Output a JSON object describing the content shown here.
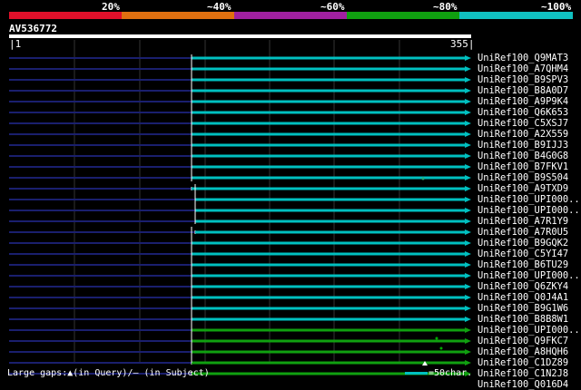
{
  "percent_scale": {
    "labels": [
      "20%",
      "~40%",
      "~60%",
      "~80%",
      "~100%"
    ],
    "colors": [
      "#e0102a",
      "#e07010",
      "#a020a0",
      "#10a010",
      "#10c0c0"
    ]
  },
  "query": {
    "name": "AV536772",
    "start": "1",
    "end": "355"
  },
  "hits": [
    {
      "label": "UniRef100_Q9MAT3",
      "color": "#00c0c0"
    },
    {
      "label": "UniRef100_A7QHM4",
      "color": "#00c0c0"
    },
    {
      "label": "UniRef100_B9SPV3",
      "color": "#00c0c0"
    },
    {
      "label": "UniRef100_B8A0D7",
      "color": "#00c0c0"
    },
    {
      "label": "UniRef100_A9P9K4",
      "color": "#00c0c0"
    },
    {
      "label": "UniRef100_Q6K653",
      "color": "#00c0c0"
    },
    {
      "label": "UniRef100_C5XSJ7",
      "color": "#00c0c0"
    },
    {
      "label": "UniRef100_A2X559",
      "color": "#00c0c0"
    },
    {
      "label": "UniRef100_B9IJJ3",
      "color": "#00c0c0"
    },
    {
      "label": "UniRef100_B4G0G8",
      "color": "#00c0c0"
    },
    {
      "label": "UniRef100_B7FKV1",
      "color": "#00c0c0"
    },
    {
      "label": "UniRef100_B9S504",
      "color": "#00c0c0"
    },
    {
      "label": "UniRef100_A9TXD9",
      "color": "#00c0c0"
    },
    {
      "label": "UniRef100_UPI000..",
      "color": "#00c0c0"
    },
    {
      "label": "UniRef100_UPI000..",
      "color": "#00c0c0"
    },
    {
      "label": "UniRef100_A7R1Y9",
      "color": "#00c0c0"
    },
    {
      "label": "UniRef100_A7R0U5",
      "color": "#00c0c0"
    },
    {
      "label": "UniRef100_B9GQK2",
      "color": "#00c0c0"
    },
    {
      "label": "UniRef100_C5YI47",
      "color": "#00c0c0"
    },
    {
      "label": "UniRef100_B6TU29",
      "color": "#00c0c0"
    },
    {
      "label": "UniRef100_UPI000..",
      "color": "#00c0c0"
    },
    {
      "label": "UniRef100_Q6ZKY4",
      "color": "#00c0c0"
    },
    {
      "label": "UniRef100_Q0J4A1",
      "color": "#00c0c0"
    },
    {
      "label": "UniRef100_B9G1W6",
      "color": "#00c0c0"
    },
    {
      "label": "UniRef100_B8B8W1",
      "color": "#00c0c0"
    },
    {
      "label": "UniRef100_UPI000..",
      "color": "#10a010"
    },
    {
      "label": "UniRef100_Q9FKC7",
      "color": "#10a010"
    },
    {
      "label": "UniRef100_A8HQH6",
      "color": "#10a010"
    },
    {
      "label": "UniRef100_C1DZ89",
      "color": "#10a010"
    },
    {
      "label": "UniRef100_C1N2J8",
      "color": "#10a010"
    },
    {
      "label": "UniRef100_Q016D4",
      "color": "#10a010"
    }
  ],
  "footer": {
    "gaps_text": "Large gaps:▲(in Query)/– (in Subject)",
    "scale_text": "=50char."
  }
}
